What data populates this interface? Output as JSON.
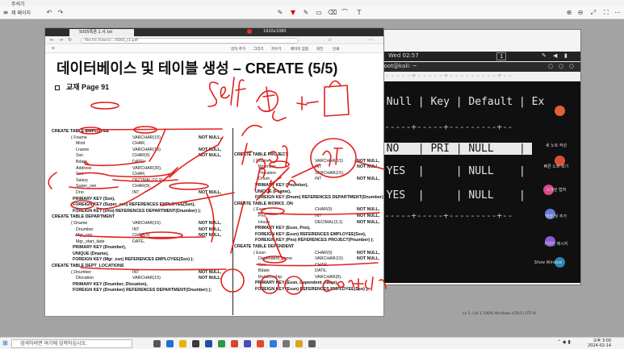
{
  "app": {
    "title": "주석기",
    "page_label": "제 페이지",
    "toolbar_icons": [
      "menu-icon",
      "undo-icon",
      "redo-icon",
      "pen-icon",
      "highlighter-icon",
      "eraser-icon",
      "zoom-in-icon",
      "zoom-out-icon",
      "fit-icon",
      "fullscreen-icon"
    ]
  },
  "browser": {
    "tab_title": "5005특론.1.사.txt",
    "url": "file:///c:/Users/.../5005_s1.pdf",
    "record_label": "1920x1080",
    "pdf_toolbar": [
      "글자 추가",
      "그리기",
      "지우기",
      "페이지 맞춤",
      "회전",
      "인쇄"
    ]
  },
  "slide": {
    "title": "데이터베이스 및 테이블 생성 – CREATE (5/5)",
    "subtitle": "교재 Page 91",
    "left_sql": [
      {
        "c1": "CREATE TABLE EMPLOYEE",
        "c2": "",
        "c3": "",
        "kw": true
      },
      {
        "c1": "( Fname",
        "c2": "VARCHAR(15)",
        "c3": "NOT NULL,"
      },
      {
        "c1": "Minit",
        "c2": "CHAR,",
        "c3": ""
      },
      {
        "c1": "Lname",
        "c2": "VARCHAR(15)",
        "c3": "NOT NULL,"
      },
      {
        "c1": "Ssn",
        "c2": "CHAR(9)",
        "c3": "NOT NULL,"
      },
      {
        "c1": "Bdate",
        "c2": "DATE,",
        "c3": ""
      },
      {
        "c1": "Address",
        "c2": "VARCHAR(30),",
        "c3": ""
      },
      {
        "c1": "Sex",
        "c2": "CHAR,",
        "c3": ""
      },
      {
        "c1": "Salary",
        "c2": "DECIMAL(10,2),",
        "c3": ""
      },
      {
        "c1": "Super_ssn",
        "c2": "CHAR(9),",
        "c3": ""
      },
      {
        "c1": "Dno",
        "c2": "INT",
        "c3": "NOT NULL,"
      },
      {
        "c1": "PRIMARY KEY (Ssn),",
        "c2": "",
        "c3": "",
        "kw": true
      },
      {
        "c1": "FOREIGN KEY (Super_ssn) REFERENCES EMPLOYEE(Ssn),",
        "c2": "",
        "c3": "",
        "kw": true
      },
      {
        "c1": "FOREIGN KEY (Dno) REFERENCES DEPARTMENT(Dnumber) );",
        "c2": "",
        "c3": "",
        "kw": true
      },
      {
        "c1": "CREATE TABLE DEPARTMENT",
        "c2": "",
        "c3": "",
        "kw": true
      },
      {
        "c1": "( Dname",
        "c2": "VARCHAR(15)",
        "c3": "NOT NULL,"
      },
      {
        "c1": "Dnumber",
        "c2": "INT",
        "c3": "NOT NULL,"
      },
      {
        "c1": "Mgr_ssn",
        "c2": "CHAR(9)",
        "c3": "NOT NULL,"
      },
      {
        "c1": "Mgr_start_date",
        "c2": "DATE,",
        "c3": ""
      },
      {
        "c1": "PRIMARY KEY (Dnumber),",
        "c2": "",
        "c3": "",
        "kw": true
      },
      {
        "c1": "UNIQUE (Dname),",
        "c2": "",
        "c3": "",
        "kw": true
      },
      {
        "c1": "FOREIGN KEY (Mgr_ssn) REFERENCES EMPLOYEE(Ssn) );",
        "c2": "",
        "c3": "",
        "kw": true
      },
      {
        "c1": "CREATE TABLE DEPT_LOCATIONS",
        "c2": "",
        "c3": "",
        "kw": true
      },
      {
        "c1": "( Dnumber",
        "c2": "INT",
        "c3": "NOT NULL,"
      },
      {
        "c1": "Dlocation",
        "c2": "VARCHAR(15)",
        "c3": "NOT NULL,"
      },
      {
        "c1": "PRIMARY KEY (Dnumber, Dlocation),",
        "c2": "",
        "c3": "",
        "kw": true
      },
      {
        "c1": "FOREIGN KEY (Dnumber) REFERENCES DEPARTMENT(Dnumber) );",
        "c2": "",
        "c3": "",
        "kw": true
      }
    ],
    "right_sql": [
      {
        "c1": "CREATE TABLE PROJECT",
        "c2": "",
        "c3": "",
        "kw": true
      },
      {
        "c1": "( Pname",
        "c2": "VARCHAR(15)",
        "c3": "NOT NULL,"
      },
      {
        "c1": "Pnumber",
        "c2": "INT",
        "c3": "NOT NULL,"
      },
      {
        "c1": "Plocation",
        "c2": "VARCHAR(15),",
        "c3": ""
      },
      {
        "c1": "Dnum",
        "c2": "INT",
        "c3": "NOT NULL,"
      },
      {
        "c1": "PRIMARY KEY (Pnumber),",
        "c2": "",
        "c3": "",
        "kw": true
      },
      {
        "c1": "UNIQUE (Pname),",
        "c2": "",
        "c3": "",
        "kw": true
      },
      {
        "c1": "FOREIGN KEY (Dnum) REFERENCES DEPARTMENT(Dnumber) );",
        "c2": "",
        "c3": "",
        "kw": true
      },
      {
        "c1": "CREATE TABLE WORKS_ON",
        "c2": "",
        "c3": "",
        "kw": true
      },
      {
        "c1": "( Essn",
        "c2": "CHAR(9)",
        "c3": "NOT NULL,"
      },
      {
        "c1": "Pno",
        "c2": "INT",
        "c3": "NOT NULL,"
      },
      {
        "c1": "Hours",
        "c2": "DECIMAL(3,1)",
        "c3": "NOT NULL,"
      },
      {
        "c1": "PRIMARY KEY (Essn, Pno),",
        "c2": "",
        "c3": "",
        "kw": true
      },
      {
        "c1": "FOREIGN KEY (Essn) REFERENCES EMPLOYEE(Ssn),",
        "c2": "",
        "c3": "",
        "kw": true
      },
      {
        "c1": "FOREIGN KEY (Pno) REFERENCES PROJECT(Pnumber) );",
        "c2": "",
        "c3": "",
        "kw": true
      },
      {
        "c1": "CREATE TABLE DEPENDENT",
        "c2": "",
        "c3": "",
        "kw": true
      },
      {
        "c1": "( Essn",
        "c2": "CHAR(9)",
        "c3": "NOT NULL,"
      },
      {
        "c1": "Dependent_name",
        "c2": "VARCHAR(15)",
        "c3": "NOT NULL,"
      },
      {
        "c1": "Sex",
        "c2": "CHAR,",
        "c3": ""
      },
      {
        "c1": "Bdate",
        "c2": "DATE,",
        "c3": ""
      },
      {
        "c1": "Relationship",
        "c2": "VARCHAR(8),",
        "c3": ""
      },
      {
        "c1": "PRIMARY KEY (Essn, Dependent_name),",
        "c2": "",
        "c3": "",
        "kw": true
      },
      {
        "c1": "FOREIGN KEY (Essn) REFERENCES EMPLOYEE(Ssn) );",
        "c2": "",
        "c3": "",
        "kw": true
      }
    ]
  },
  "vm": {
    "clock": "Wed 02:57",
    "workspace": "1",
    "terminal_title": "root@kali: ~",
    "header_row": "| Null | Key | Default | Ex",
    "rows": [
      "| NO   | PRI | NULL    |",
      "| YES  |     | NULL    |",
      "| YES  |     | NULL    |"
    ],
    "separator": "+------+-----+---------+--",
    "bottom_prompt": ")",
    "side_items": [
      "새 노트 작성",
      "빠른 노트 보기",
      "스크린 캡처",
      "펜촬 및 추가",
      "리마인 메시지",
      "Show Window"
    ],
    "status_bar": "Ln 5, Col 1   100%  Windows (CRLF)  UTF-8"
  },
  "ink": {
    "color": "#e0201c",
    "words": [
      "Self",
      "foreign",
      "FK",
      "PK",
      "constraint"
    ]
  },
  "taskbar": {
    "search_placeholder": "검색하려면 여기에 입력하십시오.",
    "time": "오후 3:00",
    "date": "2024-02-14"
  }
}
